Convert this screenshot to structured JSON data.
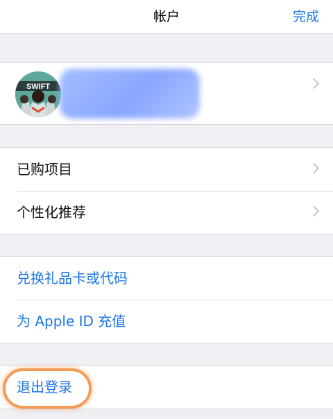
{
  "navbar": {
    "title": "帐户",
    "done_label": "完成"
  },
  "profile": {
    "avatar_icon": "avatar-icon",
    "name_obscured": true
  },
  "purchases": {
    "items": [
      {
        "label": "已购项目"
      },
      {
        "label": "个性化推荐"
      }
    ]
  },
  "store_actions": {
    "items": [
      {
        "label": "兑换礼品卡或代码"
      },
      {
        "label": "为 Apple ID 充值"
      }
    ]
  },
  "session": {
    "signout_label": "退出登录"
  },
  "colors": {
    "accent": "#1b75e8",
    "background": "#efeff4",
    "highlight": "#f39b57"
  }
}
